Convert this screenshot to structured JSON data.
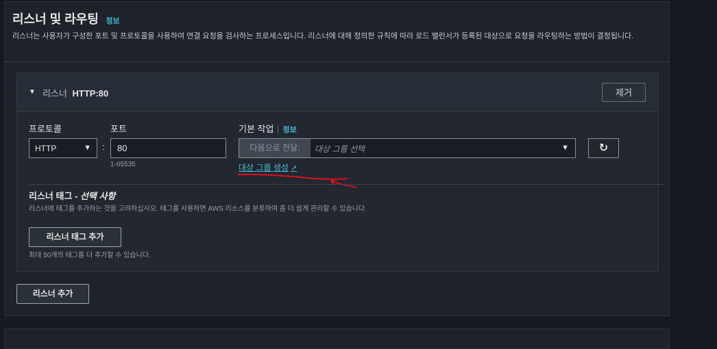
{
  "section": {
    "title": "리스너 및 라우팅",
    "info_label": "정보",
    "description": "리스너는 사용자가 구성한 포트 및 프로토콜을 사용하여 연결 요청을 검사하는 프로세스입니다. 리스너에 대해 정의한 규칙에 따라 로드 밸런서가 등록된 대상으로 요청을 라우팅하는 방법이 결정됩니다."
  },
  "listener": {
    "label": "리스너",
    "name": "HTTP:80",
    "remove_label": "제거",
    "protocol_label": "프로토콜",
    "protocol_value": "HTTP",
    "port_label": "포트",
    "port_value": "80",
    "port_hint": "1-65535",
    "default_action_label": "기본 작업",
    "info_label": "정보",
    "action_prefix": "다음으로 전달:",
    "target_group_placeholder": "대상 그룹 선택",
    "create_target_group_label": "대상 그룹 생성",
    "tags_title": "리스너 태그 - ",
    "tags_title_optional": "선택 사항",
    "tags_description": "리스너에 태그를 추가하는 것을 고려하십시오. 태그를 사용하면 AWS 리소스를 분류하여 좀 더 쉽게 관리할 수 있습니다.",
    "add_tag_label": "리스너 태그 추가",
    "tag_limit_hint": "최대 50개의 태그를 더 추가할 수 있습니다."
  },
  "add_listener_label": "리스너 추가",
  "icons": {
    "caret": "caret-down-icon",
    "select_arrow": "chevron-down-icon",
    "refresh": "refresh-icon",
    "external": "external-link-icon"
  },
  "colors": {
    "link": "#44b9d6",
    "annotation": "#e0101a"
  }
}
